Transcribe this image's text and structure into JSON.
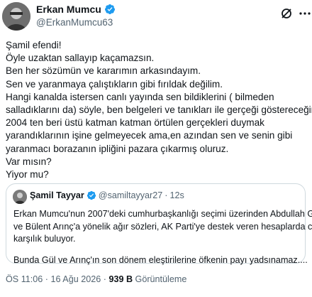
{
  "author": {
    "name": "Erkan Mumcu",
    "handle": "@ErkanMumcu63"
  },
  "tweet": {
    "lines": [
      "Şamil efendi!",
      "Öyle uzaktan sallayıp kaçamazsın.",
      "Ben her sözümün ve kararımın arkasındayım.",
      "Sen ve yaranmaya çalıştıkların gibi fırıldak değilim.",
      "Hangi kanalda istersen canlı yayında sen bildiklerini ( bilmeden",
      "salladıklarını da) söyle, ben belgeleri ve tanıkları ile gerçeği göstereceğim.",
      "2004 ten beri üstü katman katman örtülen gerçekleri duymak",
      "yarandıklarının işine gelmeyecek ama,en azından sen ve senin gibi",
      "yaranmacı borazanın ipliğini pazara çıkarmış oluruz.",
      "Var mısın?",
      "Yiyor mu?"
    ]
  },
  "quote": {
    "name": "Şamil Tayyar",
    "handle": "@samiltayyar27",
    "separator": "·",
    "time": "12s",
    "para1": [
      "Erkan Mumcu'nun 2007'deki cumhurbaşkanlığı seçimi üzerinden Abdullah Gül",
      "ve Bülent Arınç'a yönelik ağır sözleri, AK Parti'ye destek veren hesaplarda ciddi",
      "karşılık buluyor."
    ],
    "para2": "Bunda Gül ve Arınç'ın son dönem eleştirilerine öfkenin payı yadsınamaz...."
  },
  "meta": {
    "time": "ÖS 11:06",
    "separator": "·",
    "date": "16 Ağu 2026",
    "views_count": "939 B",
    "views_label": "Görüntüleme"
  },
  "colors": {
    "verified": "#1d9bf0",
    "text": "#0f1419",
    "secondary": "#536471",
    "border": "#cfd9de"
  },
  "icons": {
    "verified": "verified-badge-icon",
    "grok": "grok-icon",
    "more": "more-options-icon"
  }
}
